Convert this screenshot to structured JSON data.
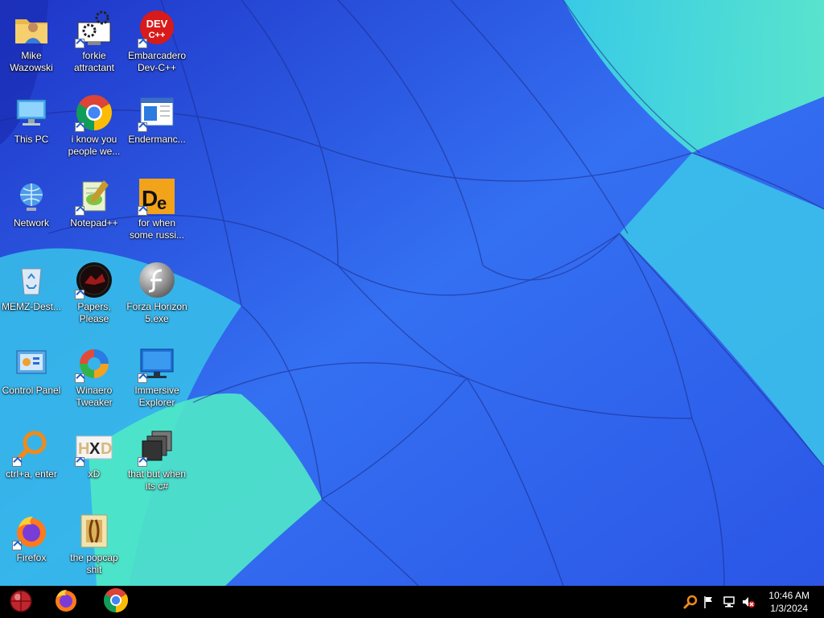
{
  "desktop": {
    "icons": [
      {
        "label": "Mike Wazowski",
        "icon": "folder-user-icon"
      },
      {
        "label": "forkie attractant",
        "icon": "gears-monitor-icon"
      },
      {
        "label": "Embarcadero Dev-C++",
        "icon": "devcpp-icon"
      },
      {
        "label": "This PC",
        "icon": "computer-icon"
      },
      {
        "label": "i know you people we...",
        "icon": "chrome-icon"
      },
      {
        "label": "Endermanc...",
        "icon": "window-app-icon"
      },
      {
        "label": "Network",
        "icon": "network-globe-icon"
      },
      {
        "label": "Notepad++",
        "icon": "notepadpp-icon"
      },
      {
        "label": "for when some russi...",
        "icon": "de-icon"
      },
      {
        "label": "MEMZ-Dest...",
        "icon": "recycle-bin-icon"
      },
      {
        "label": "Papers, Please",
        "icon": "papers-please-icon"
      },
      {
        "label": "Forza Horizon 5.exe",
        "icon": "flash-icon"
      },
      {
        "label": "Control Panel",
        "icon": "control-panel-icon"
      },
      {
        "label": "Winaero Tweaker",
        "icon": "winaero-icon"
      },
      {
        "label": "Immersive Explorer",
        "icon": "monitor-blue-icon"
      },
      {
        "label": "ctrl+a, enter",
        "icon": "magnifier-icon"
      },
      {
        "label": "xD",
        "icon": "hxd-icon"
      },
      {
        "label": "that but when its c#",
        "icon": "stacked-windows-icon"
      },
      {
        "label": "Firefox",
        "icon": "firefox-icon"
      },
      {
        "label": "the popcap shit",
        "icon": "popcap-icon"
      }
    ]
  },
  "taskbar": {
    "start": {
      "icon": "start-orb-icon"
    },
    "pinned": [
      {
        "name": "Firefox",
        "icon": "firefox-icon"
      },
      {
        "name": "Google Chrome",
        "icon": "chrome-icon"
      }
    ],
    "tray": [
      {
        "name": "search",
        "icon": "magnifier-tray-icon"
      },
      {
        "name": "action-center",
        "icon": "flag-icon"
      },
      {
        "name": "network",
        "icon": "network-tray-icon"
      },
      {
        "name": "volume",
        "icon": "speaker-muted-icon"
      }
    ],
    "clock": {
      "time": "10:46 AM",
      "date": "1/3/2024"
    }
  },
  "colors": {
    "taskbar": "#000000",
    "label_text": "#ffffff",
    "accent_blue": "#2b5ff0",
    "accent_cyan": "#47e0d8"
  }
}
